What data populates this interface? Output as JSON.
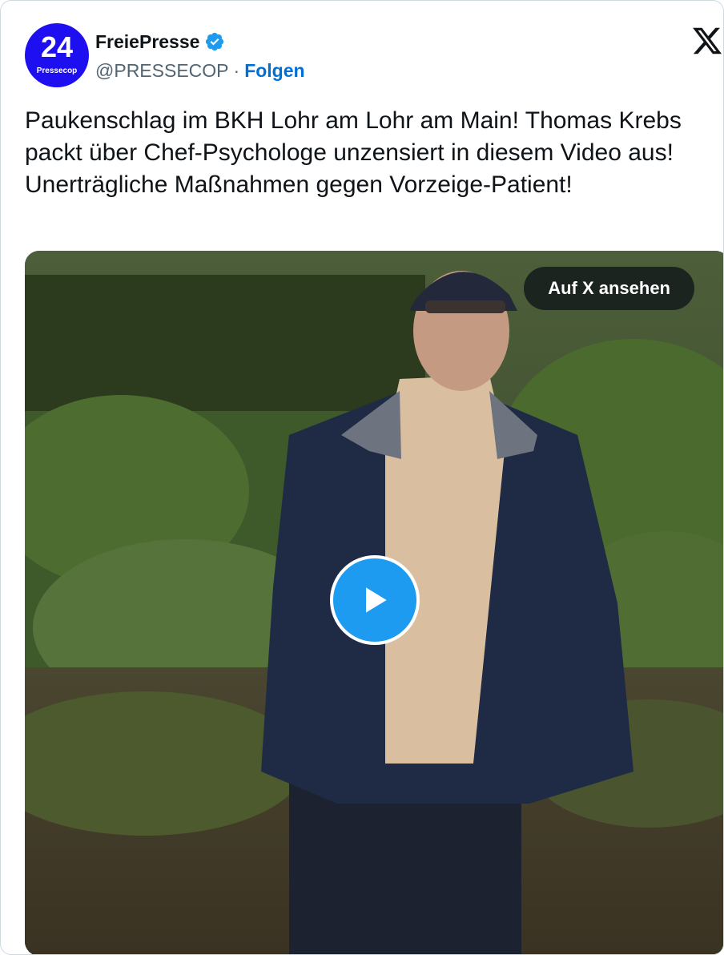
{
  "account": {
    "avatar_number": "24",
    "avatar_caption": "Pressecop",
    "display_name": "FreiePresse",
    "handle": "@PRESSECOP",
    "separator": "·",
    "follow_label": "Folgen",
    "verified": true
  },
  "icons": {
    "verified": "verified-badge-icon",
    "platform": "x-logo-icon",
    "play": "play-icon"
  },
  "tweet": {
    "text": "Paukenschlag im BKH Lohr am Lohr am Main! Thomas Krebs packt über Chef-Psychologe unzensiert in diesem Video aus! Unerträgliche Maßnahmen gegen Vorzeige-Patient!"
  },
  "media": {
    "watch_label": "Auf X ansehen"
  },
  "colors": {
    "avatar_bg": "#1d0ff0",
    "link": "#006fd6",
    "play_button": "#1d9bf0",
    "text": "#0f1419",
    "muted": "#536471"
  }
}
